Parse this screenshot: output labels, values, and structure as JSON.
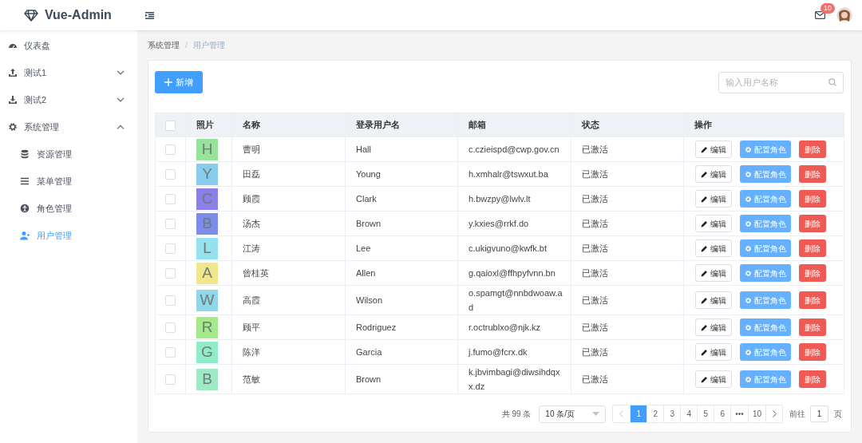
{
  "header": {
    "logo": "Vue-Admin",
    "mail_badge": "10"
  },
  "sidebar": {
    "items": [
      {
        "label": "仪表盘",
        "selected": false
      },
      {
        "label": "测试1",
        "expanded": false,
        "selected": false
      },
      {
        "label": "测试2",
        "expanded": false,
        "selected": false
      },
      {
        "label": "系统管理",
        "expanded": true,
        "selected": false,
        "children": [
          {
            "label": "资源管理",
            "selected": false
          },
          {
            "label": "菜单管理",
            "selected": false
          },
          {
            "label": "角色管理",
            "selected": false
          },
          {
            "label": "用户管理",
            "selected": true
          }
        ]
      }
    ]
  },
  "breadcrumb": {
    "items": [
      "系统管理",
      "用户管理"
    ],
    "separator": "/"
  },
  "toolbar": {
    "add_button": "新增",
    "search_placeholder": "输入用户名称"
  },
  "table": {
    "select_all_checked": false,
    "columns": [
      "照片",
      "名称",
      "登录用户名",
      "邮箱",
      "状态",
      "操作"
    ],
    "rows": [
      {
        "checked": false,
        "avatar": "H",
        "color": "#95e49a",
        "name": "曹明",
        "login": "Hall",
        "email": "c.czieispd@cwp.gov.cn",
        "status": "已激活",
        "actions": [
          "编辑",
          "配置角色",
          "删除"
        ]
      },
      {
        "checked": false,
        "avatar": "Y",
        "color": "#88cdee",
        "name": "田磊",
        "login": "Young",
        "email": "h.xmhalr@tswxut.ba",
        "status": "已激活",
        "actions": [
          "编辑",
          "配置角色",
          "删除"
        ]
      },
      {
        "checked": false,
        "avatar": "C",
        "color": "#8a80e8",
        "name": "顾霞",
        "login": "Clark",
        "email": "h.bwzpy@lwlv.lt",
        "status": "已激活",
        "actions": [
          "编辑",
          "配置角色",
          "删除"
        ]
      },
      {
        "checked": false,
        "avatar": "B",
        "color": "#7b8de8",
        "name": "汤杰",
        "login": "Brown",
        "email": "y.kxies@rrkf.do",
        "status": "已激活",
        "actions": [
          "编辑",
          "配置角色",
          "删除"
        ]
      },
      {
        "checked": false,
        "avatar": "L",
        "color": "#94e2ee",
        "name": "江涛",
        "login": "Lee",
        "email": "c.ukigvuno@kwfk.bt",
        "status": "已激活",
        "actions": [
          "编辑",
          "配置角色",
          "删除"
        ]
      },
      {
        "checked": false,
        "avatar": "A",
        "color": "#f0e68a",
        "name": "曾桂英",
        "login": "Allen",
        "email": "g.qaioxl@ffhpyfvnn.bn",
        "status": "已激活",
        "actions": [
          "编辑",
          "配置角色",
          "删除"
        ]
      },
      {
        "checked": false,
        "avatar": "W",
        "color": "#8ed8ea",
        "name": "高霞",
        "login": "Wilson",
        "email": "o.spamgt@nnbdwoaw.ad",
        "status": "已激活",
        "actions": [
          "编辑",
          "配置角色",
          "删除"
        ]
      },
      {
        "checked": false,
        "avatar": "R",
        "color": "#a4e98a",
        "name": "顾平",
        "login": "Rodriguez",
        "email": "r.octrublxo@njk.kz",
        "status": "已激活",
        "actions": [
          "编辑",
          "配置角色",
          "删除"
        ]
      },
      {
        "checked": false,
        "avatar": "G",
        "color": "#90ecc8",
        "name": "陈洋",
        "login": "Garcia",
        "email": "j.fumo@fcrx.dk",
        "status": "已激活",
        "actions": [
          "编辑",
          "配置角色",
          "删除"
        ]
      },
      {
        "checked": false,
        "avatar": "B",
        "color": "#9eeac4",
        "name": "范敏",
        "login": "Brown",
        "email": "k.jbvimbagi@diwsihdqxx.dz",
        "status": "已激活",
        "actions": [
          "编辑",
          "配置角色",
          "删除"
        ]
      }
    ]
  },
  "pagination": {
    "total": "共 99 条",
    "page_size": "10 条/页",
    "pages": [
      {
        "label": "1",
        "selected": true
      },
      {
        "label": "2",
        "selected": false
      },
      {
        "label": "3",
        "selected": false
      },
      {
        "label": "4",
        "selected": false
      },
      {
        "label": "5",
        "selected": false
      },
      {
        "label": "6",
        "selected": false
      },
      {
        "label": "•••",
        "selected": false
      },
      {
        "label": "10",
        "selected": false
      }
    ],
    "goto_label": "前往",
    "goto_value": "1",
    "page_suffix": "页"
  }
}
